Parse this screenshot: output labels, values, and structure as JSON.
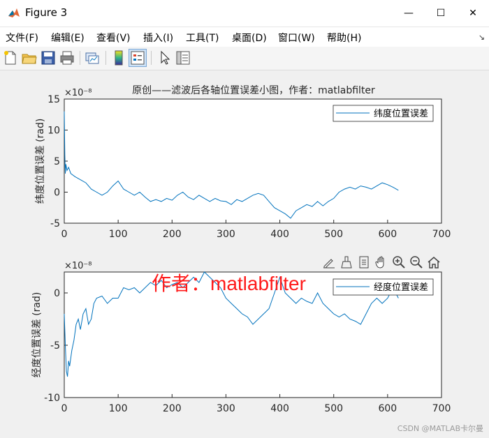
{
  "window": {
    "title": "Figure 3",
    "minimize": "—",
    "maximize": "☐",
    "close": "✕"
  },
  "menu": [
    {
      "label": "文件(F)"
    },
    {
      "label": "编辑(E)"
    },
    {
      "label": "查看(V)"
    },
    {
      "label": "插入(I)"
    },
    {
      "label": "工具(T)"
    },
    {
      "label": "桌面(D)"
    },
    {
      "label": "窗口(W)"
    },
    {
      "label": "帮助(H)"
    }
  ],
  "menu_overflow": "↘",
  "toolbar_icons": [
    "new-figure-icon",
    "open-file-icon",
    "save-icon",
    "print-icon",
    "link-plot-icon",
    "colorbar-icon",
    "legend-icon",
    "pointer-icon",
    "property-editor-icon"
  ],
  "axes_toolbar_icons": [
    "brush-edit-icon",
    "data-brush-icon",
    "data-tips-icon",
    "pan-hand-icon",
    "zoom-in-icon",
    "zoom-out-icon",
    "home-icon"
  ],
  "watermark": "作者：matlabfilter",
  "csdn_mark": "CSDN @MATLAB卡尔曼",
  "colors": {
    "line": "#0072bd",
    "axes_bg": "#ffffff",
    "figure_bg": "#f0f0f0",
    "watermark": "#ff1a1a"
  },
  "chart_data": [
    {
      "type": "line",
      "title": "原创——滤波后各轴位置误差小图，作者：matlabfilter",
      "exponent_label": "×10⁻⁸",
      "xlabel": "",
      "ylabel": "纬度位置误差 (rad)",
      "xlim": [
        0,
        700
      ],
      "ylim": [
        -5,
        15
      ],
      "xticks": [
        0,
        100,
        200,
        300,
        400,
        500,
        600,
        700
      ],
      "yticks": [
        -5,
        0,
        5,
        10,
        15
      ],
      "grid": false,
      "legend_position": "top-right",
      "series": [
        {
          "name": "纬度位置误差",
          "x": [
            0,
            1,
            2,
            3,
            5,
            8,
            12,
            20,
            30,
            40,
            50,
            60,
            70,
            80,
            90,
            100,
            110,
            120,
            130,
            140,
            150,
            160,
            170,
            180,
            190,
            200,
            210,
            220,
            230,
            240,
            250,
            260,
            270,
            280,
            290,
            300,
            310,
            320,
            330,
            340,
            350,
            360,
            370,
            380,
            390,
            400,
            410,
            420,
            430,
            440,
            450,
            460,
            470,
            480,
            490,
            500,
            510,
            520,
            530,
            540,
            550,
            560,
            570,
            580,
            590,
            600,
            610,
            620
          ],
          "y": [
            13,
            6,
            3,
            4.5,
            3.5,
            4,
            3,
            2.5,
            2,
            1.5,
            0.5,
            0,
            -0.5,
            0,
            1,
            1.8,
            0.5,
            0,
            -0.5,
            0,
            -0.8,
            -1.5,
            -1.2,
            -1.5,
            -1,
            -1.3,
            -0.5,
            0,
            -0.8,
            -1.2,
            -0.5,
            -1,
            -1.5,
            -1,
            -1.4,
            -1.5,
            -2,
            -1.2,
            -1.5,
            -1,
            -0.5,
            -0.2,
            -0.5,
            -1.5,
            -2.5,
            -3,
            -3.5,
            -4.2,
            -3,
            -2.5,
            -2,
            -2.3,
            -1.5,
            -2.2,
            -1.5,
            -1,
            0,
            0.5,
            0.8,
            0.5,
            1,
            0.8,
            0.5,
            1,
            1.5,
            1.2,
            0.8,
            0.3
          ]
        }
      ]
    },
    {
      "type": "line",
      "title": "",
      "exponent_label": "×10⁻⁸",
      "xlabel": "",
      "ylabel": "经度位置误差 (rad)",
      "xlim": [
        0,
        700
      ],
      "ylim": [
        -10,
        2
      ],
      "xticks": [
        0,
        100,
        200,
        300,
        400,
        500,
        600,
        700
      ],
      "yticks": [
        -10,
        -5,
        0
      ],
      "grid": false,
      "legend_position": "top-right",
      "series": [
        {
          "name": "经度位置误差",
          "x": [
            0,
            2,
            4,
            6,
            8,
            10,
            14,
            18,
            22,
            26,
            30,
            35,
            40,
            45,
            50,
            55,
            60,
            70,
            80,
            90,
            100,
            110,
            120,
            130,
            140,
            150,
            160,
            170,
            180,
            190,
            200,
            210,
            220,
            230,
            240,
            250,
            260,
            270,
            280,
            290,
            300,
            310,
            320,
            330,
            340,
            350,
            360,
            370,
            380,
            390,
            400,
            410,
            420,
            430,
            440,
            450,
            460,
            470,
            480,
            490,
            500,
            510,
            520,
            530,
            540,
            550,
            560,
            570,
            580,
            590,
            600,
            610,
            620
          ],
          "y": [
            -2,
            -5,
            -7.5,
            -8,
            -6.5,
            -7,
            -5.5,
            -4.5,
            -3,
            -2.5,
            -3.5,
            -2,
            -1.5,
            -3,
            -2.5,
            -1,
            -0.5,
            -0.3,
            -1,
            -0.5,
            -0.5,
            0.5,
            0.3,
            0.5,
            0,
            0.5,
            1,
            0.7,
            1.2,
            0.5,
            0.8,
            1,
            0.5,
            1,
            1.5,
            1,
            2,
            1.5,
            1,
            0.5,
            -0.5,
            -1,
            -1.5,
            -2,
            -2.3,
            -3,
            -2.5,
            -2,
            -1.5,
            0,
            1.5,
            0,
            -0.5,
            -1,
            -0.5,
            -0.8,
            -1,
            0,
            -1,
            -1.5,
            -2,
            -2.3,
            -2,
            -2.5,
            -2.7,
            -3,
            -2,
            -1,
            -0.5,
            -1,
            -0.5,
            0.5,
            -0.5
          ]
        }
      ]
    }
  ]
}
